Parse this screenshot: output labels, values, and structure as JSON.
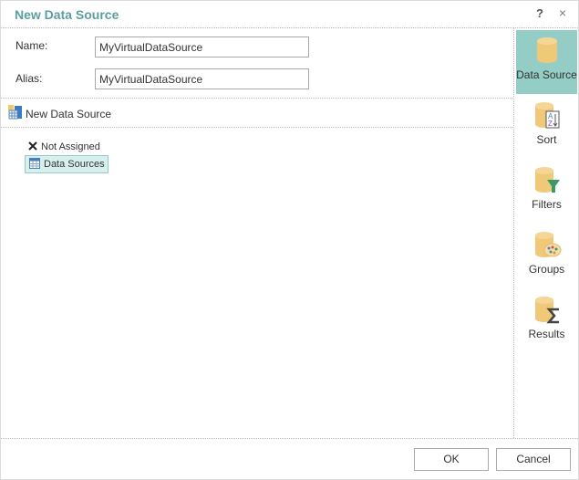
{
  "dialog": {
    "title": "New Data Source",
    "help_label": "?",
    "close_label": "×"
  },
  "form": {
    "name_label": "Name:",
    "name_value": "MyVirtualDataSource",
    "alias_label": "Alias:",
    "alias_value": "MyVirtualDataSource"
  },
  "datasource_header": {
    "icon": "new-datasource-icon",
    "label": "New Data Source"
  },
  "tree": {
    "items": [
      {
        "icon": "x-icon",
        "label": "Not Assigned",
        "selected": false
      },
      {
        "icon": "table-icon",
        "label": "Data Sources",
        "selected": true
      }
    ]
  },
  "nav": {
    "items": [
      {
        "label": "Data Source",
        "icon": "database-icon",
        "active": true
      },
      {
        "label": "Sort",
        "icon": "sort-az-icon",
        "active": false
      },
      {
        "label": "Filters",
        "icon": "filter-icon",
        "active": false
      },
      {
        "label": "Groups",
        "icon": "palette-icon",
        "active": false
      },
      {
        "label": "Results",
        "icon": "sigma-icon",
        "active": false
      }
    ]
  },
  "footer": {
    "ok_label": "OK",
    "cancel_label": "Cancel"
  },
  "colors": {
    "title": "#5c9ea0",
    "nav_active_bg": "#94ccc6",
    "tree_selected_bg": "#d7f0ee",
    "db_icon": "#f0c978"
  }
}
